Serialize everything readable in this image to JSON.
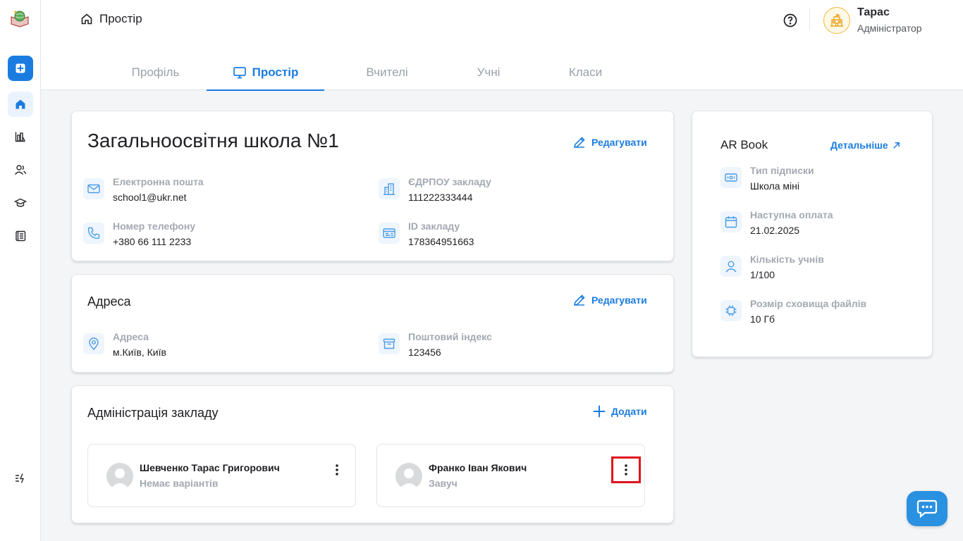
{
  "header": {
    "breadcrumb": "Простір",
    "user": {
      "name": "Тарас",
      "role": "Адміністратор"
    }
  },
  "tabs": [
    {
      "label": "Профіль",
      "active": false
    },
    {
      "label": "Простір",
      "active": true
    },
    {
      "label": "Вчителі",
      "active": false
    },
    {
      "label": "Учні",
      "active": false
    },
    {
      "label": "Класи",
      "active": false
    }
  ],
  "school": {
    "title": "Загальноосвітня школа №1",
    "edit_label": "Редагувати",
    "email_label": "Електронна пошта",
    "email": "school1@ukr.net",
    "edrpou_label": "ЄДРПОУ закладу",
    "edrpou": "111222333444",
    "phone_label": "Номер телефону",
    "phone": "+380 66 111 2233",
    "id_label": "ID закладу",
    "id": "178364951663"
  },
  "address": {
    "title": "Адреса",
    "edit_label": "Редагувати",
    "address_label": "Адреса",
    "address": "м.Київ, Київ",
    "postal_label": "Поштовий індекс",
    "postal": "123456"
  },
  "administration": {
    "title": "Адміністрація закладу",
    "add_label": "Додати",
    "people": [
      {
        "name": "Шевченко Тарас Григорович",
        "role": "Немає варіантів"
      },
      {
        "name": "Франко Іван Якович",
        "role": "Завуч"
      }
    ]
  },
  "ar_book": {
    "title": "AR Book",
    "details_label": "Детальніше",
    "subscription_label": "Тип підписки",
    "subscription": "Школа міні",
    "payment_label": "Наступна оплата",
    "payment": "21.02.2025",
    "students_label": "Кількість учнів",
    "students": "1/100",
    "storage_label": "Розмір сховища файлів",
    "storage": "10 Гб"
  },
  "colors": {
    "accent": "#1b7ce0",
    "highlight": "#e0141e"
  }
}
